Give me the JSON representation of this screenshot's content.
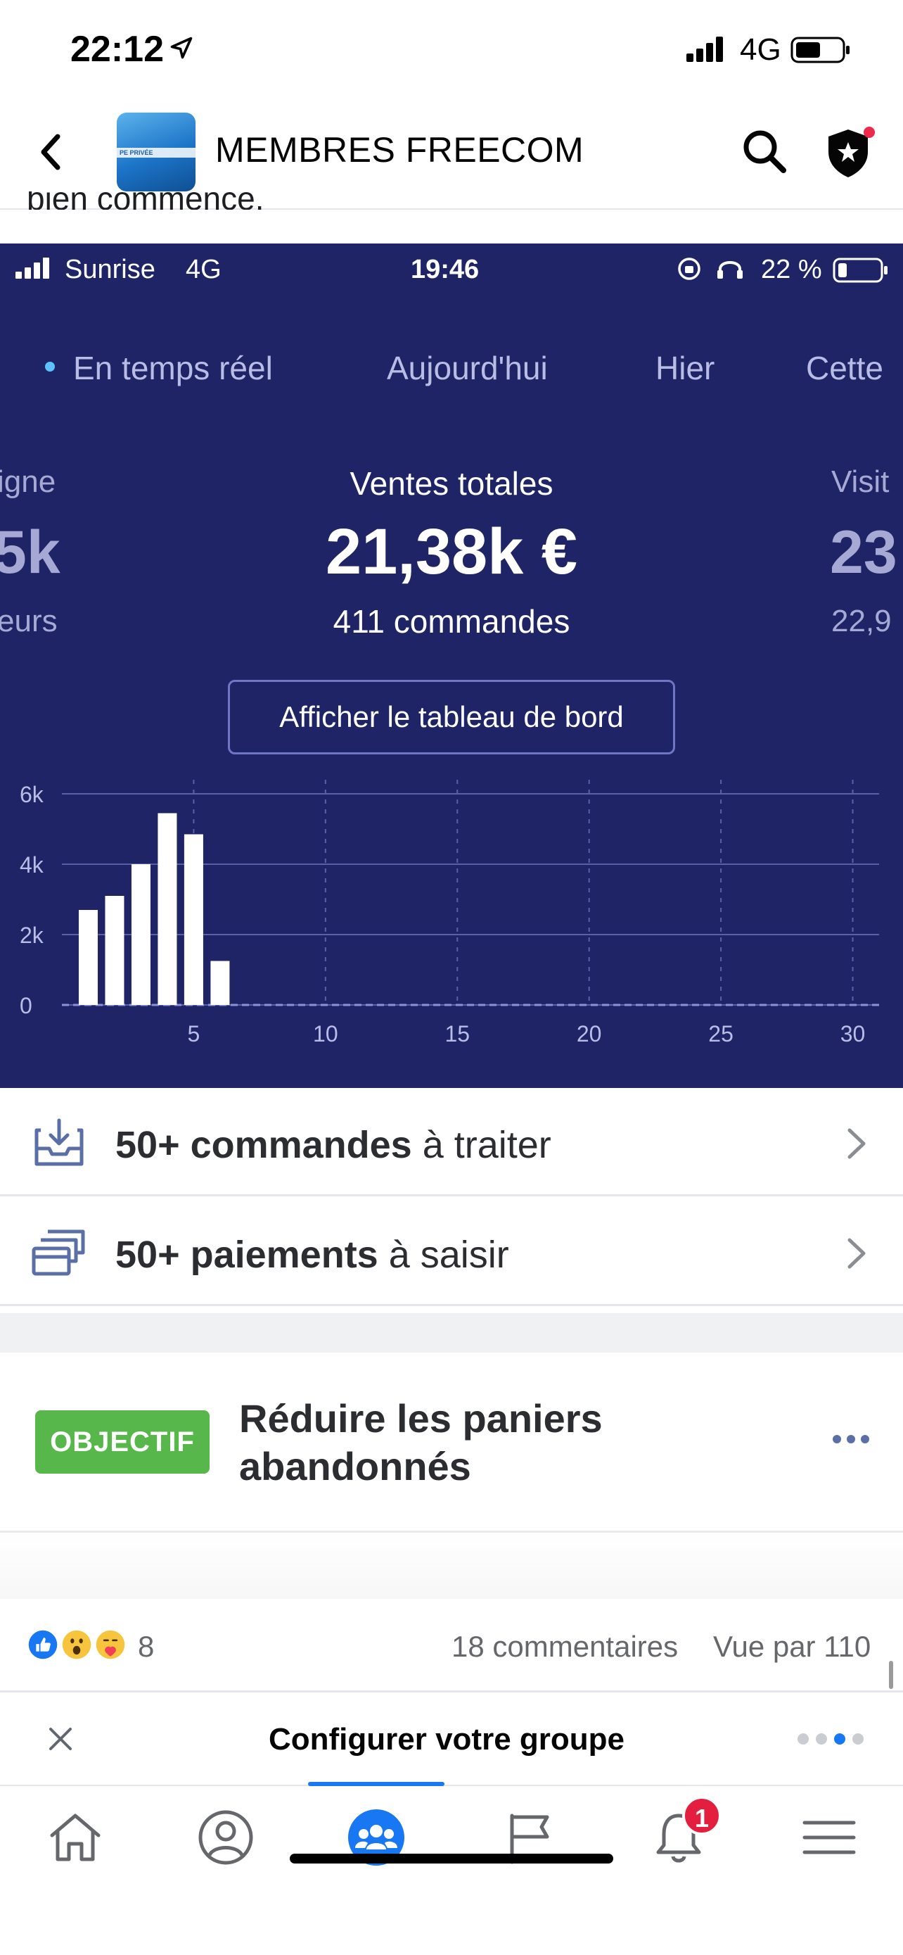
{
  "status_bar": {
    "time": "22:12",
    "network": "4G"
  },
  "header": {
    "group_title": "MEMBRES FREECOM",
    "thumb_text": "PE PRIVÉE"
  },
  "post": {
    "cut_text": "bien commencé."
  },
  "embedded": {
    "status": {
      "carrier": "Sunrise",
      "network": "4G",
      "time": "19:46",
      "battery": "22 %"
    },
    "tabs": [
      "En temps réel",
      "Aujourd'hui",
      "Hier",
      "Cette"
    ],
    "left_metric": {
      "label": "igne",
      "value": "5k",
      "sub": "eurs"
    },
    "center_metric": {
      "label": "Ventes totales",
      "value": "21,38k €",
      "sub": "411 commandes"
    },
    "right_metric": {
      "label": "Visit",
      "value": "23",
      "sub": "22,9"
    },
    "dashboard_button": "Afficher le tableau de bord"
  },
  "chart_data": {
    "type": "bar",
    "x": [
      1,
      2,
      3,
      4,
      5,
      6
    ],
    "values": [
      2700,
      3100,
      4000,
      5450,
      4850,
      1250
    ],
    "xlim": [
      0,
      31
    ],
    "ylim": [
      0,
      6000
    ],
    "xticks": [
      "5",
      "10",
      "15",
      "20",
      "25",
      "30"
    ],
    "yticks": [
      "0",
      "2k",
      "4k",
      "6k"
    ],
    "grid": true,
    "colors": {
      "bars": "#ffffff",
      "background": "#1e2465",
      "grid": "#5a60a8"
    }
  },
  "rows": [
    {
      "bold": "50+ commandes",
      "rest": " à traiter",
      "icon": "inbox-tray-icon"
    },
    {
      "bold": "50+ paiements",
      "rest": " à saisir",
      "icon": "payment-stack-icon"
    }
  ],
  "goal": {
    "badge": "OBJECTIF",
    "text": "Réduire les paniers abandonnés"
  },
  "reactions": {
    "count": "8",
    "comments": "18 commentaires",
    "views": "Vue par 110"
  },
  "config_banner": {
    "title": "Configurer votre groupe"
  },
  "nav": {
    "notifications_badge": "1"
  },
  "colors": {
    "accent": "#1877f2",
    "badge_green": "#57b74a",
    "dark_panel": "#1e2465",
    "alert_red": "#e41e3f"
  }
}
